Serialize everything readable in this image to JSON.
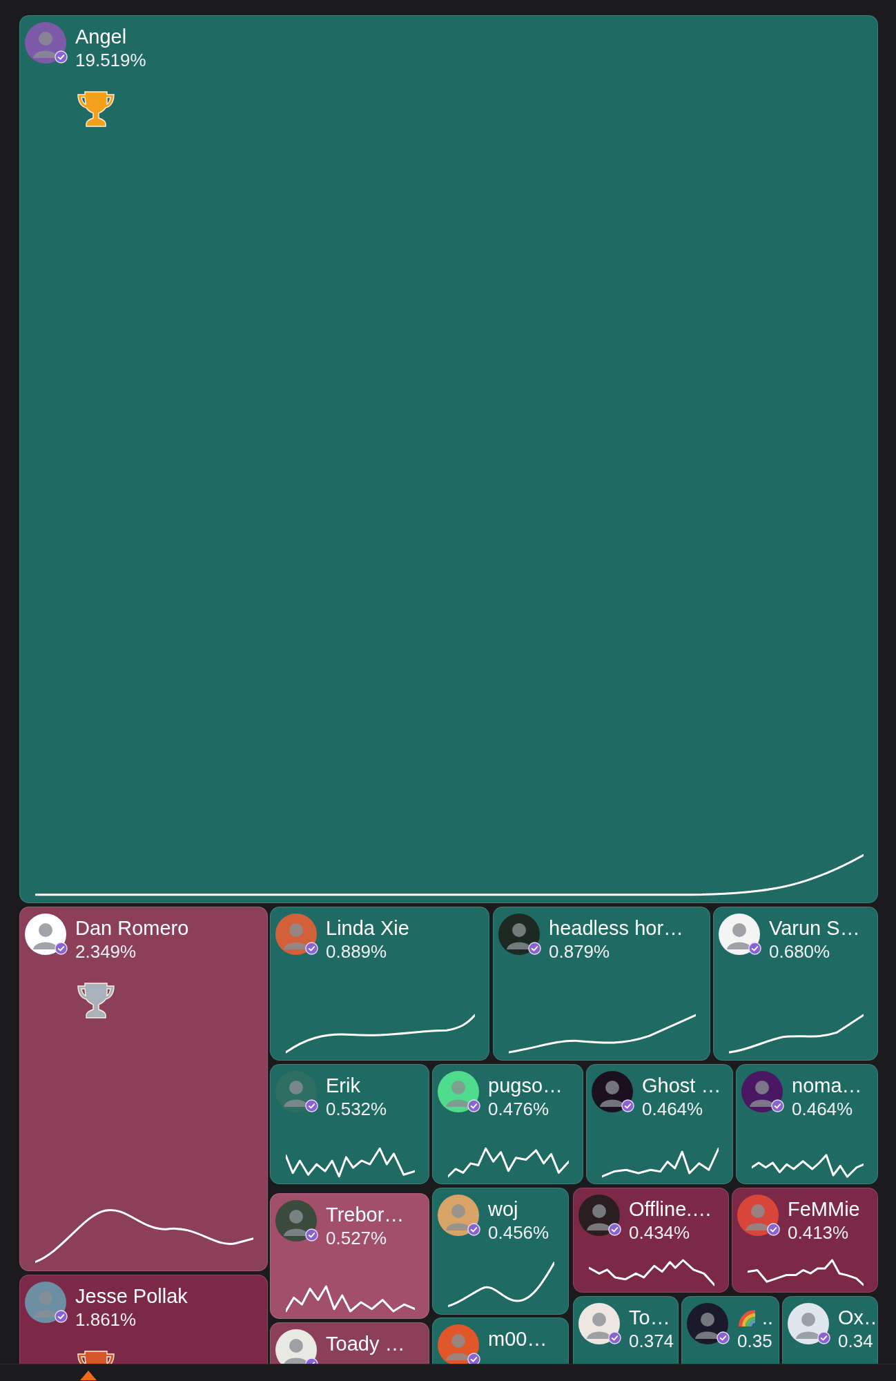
{
  "tiles": [
    {
      "name": "Angel",
      "share": "19.519%",
      "color": "#1f6b64",
      "verified": true,
      "trophy": {
        "color": "#f3a11b"
      },
      "sparkline": true
    },
    {
      "name": "Dan Romero",
      "share": "2.349%",
      "color": "#8b3f58",
      "verified": true,
      "trophy": {
        "color": "#a9b1ba"
      },
      "sparkline": true
    },
    {
      "name": "Jesse Pollak",
      "share": "1.861%",
      "color": "#7c2947",
      "verified": true,
      "trophy": {
        "color": "#d5582a"
      },
      "sparkline": false
    },
    {
      "name": "Linda Xie",
      "share": "0.889%",
      "color": "#1f6b64",
      "verified": true,
      "sparkline": true
    },
    {
      "name": "headless hor…",
      "share": "0.879%",
      "color": "#1f6b64",
      "verified": true,
      "sparkline": true
    },
    {
      "name": "Varun S…",
      "share": "0.680%",
      "color": "#1f6b64",
      "verified": true,
      "sparkline": true
    },
    {
      "name": "Erik",
      "share": "0.532%",
      "color": "#1f6b64",
      "verified": true,
      "sparkline": true
    },
    {
      "name": "pugso…",
      "share": "0.476%",
      "color": "#1f6b64",
      "verified": true,
      "sparkline": true
    },
    {
      "name": "Ghost …",
      "share": "0.464%",
      "color": "#1f6b64",
      "verified": true,
      "sparkline": true
    },
    {
      "name": "noma…",
      "share": "0.464%",
      "color": "#1f6b64",
      "verified": true,
      "sparkline": true
    },
    {
      "name": "Trebor…",
      "share": "0.527%",
      "color": "#a24f6c",
      "verified": true,
      "sparkline": true
    },
    {
      "name": "Toady …",
      "color": "#8b3f58",
      "verified": true,
      "sparkline": false
    },
    {
      "name": "woj",
      "share": "0.456%",
      "color": "#1f6b64",
      "verified": true,
      "sparkline": true
    },
    {
      "name": "m00…",
      "color": "#1f6b64",
      "verified": true,
      "sparkline": false
    },
    {
      "name": "Offline.…",
      "share": "0.434%",
      "color": "#7c2947",
      "verified": true,
      "sparkline": true
    },
    {
      "name": "FeMMie",
      "share": "0.413%",
      "color": "#7c2947",
      "verified": true,
      "sparkline": true
    },
    {
      "name": "To…",
      "share": "0.374",
      "color": "#1f6b64",
      "verified": true,
      "sparkline": false
    },
    {
      "name": "..",
      "kind": "rainbow",
      "share": "0.35",
      "color": "#1f6b64",
      "verified": true,
      "sparkline": false
    },
    {
      "name": "Ox…",
      "share": "0.34",
      "color": "#1f6b64",
      "verified": true,
      "sparkline": false
    }
  ]
}
